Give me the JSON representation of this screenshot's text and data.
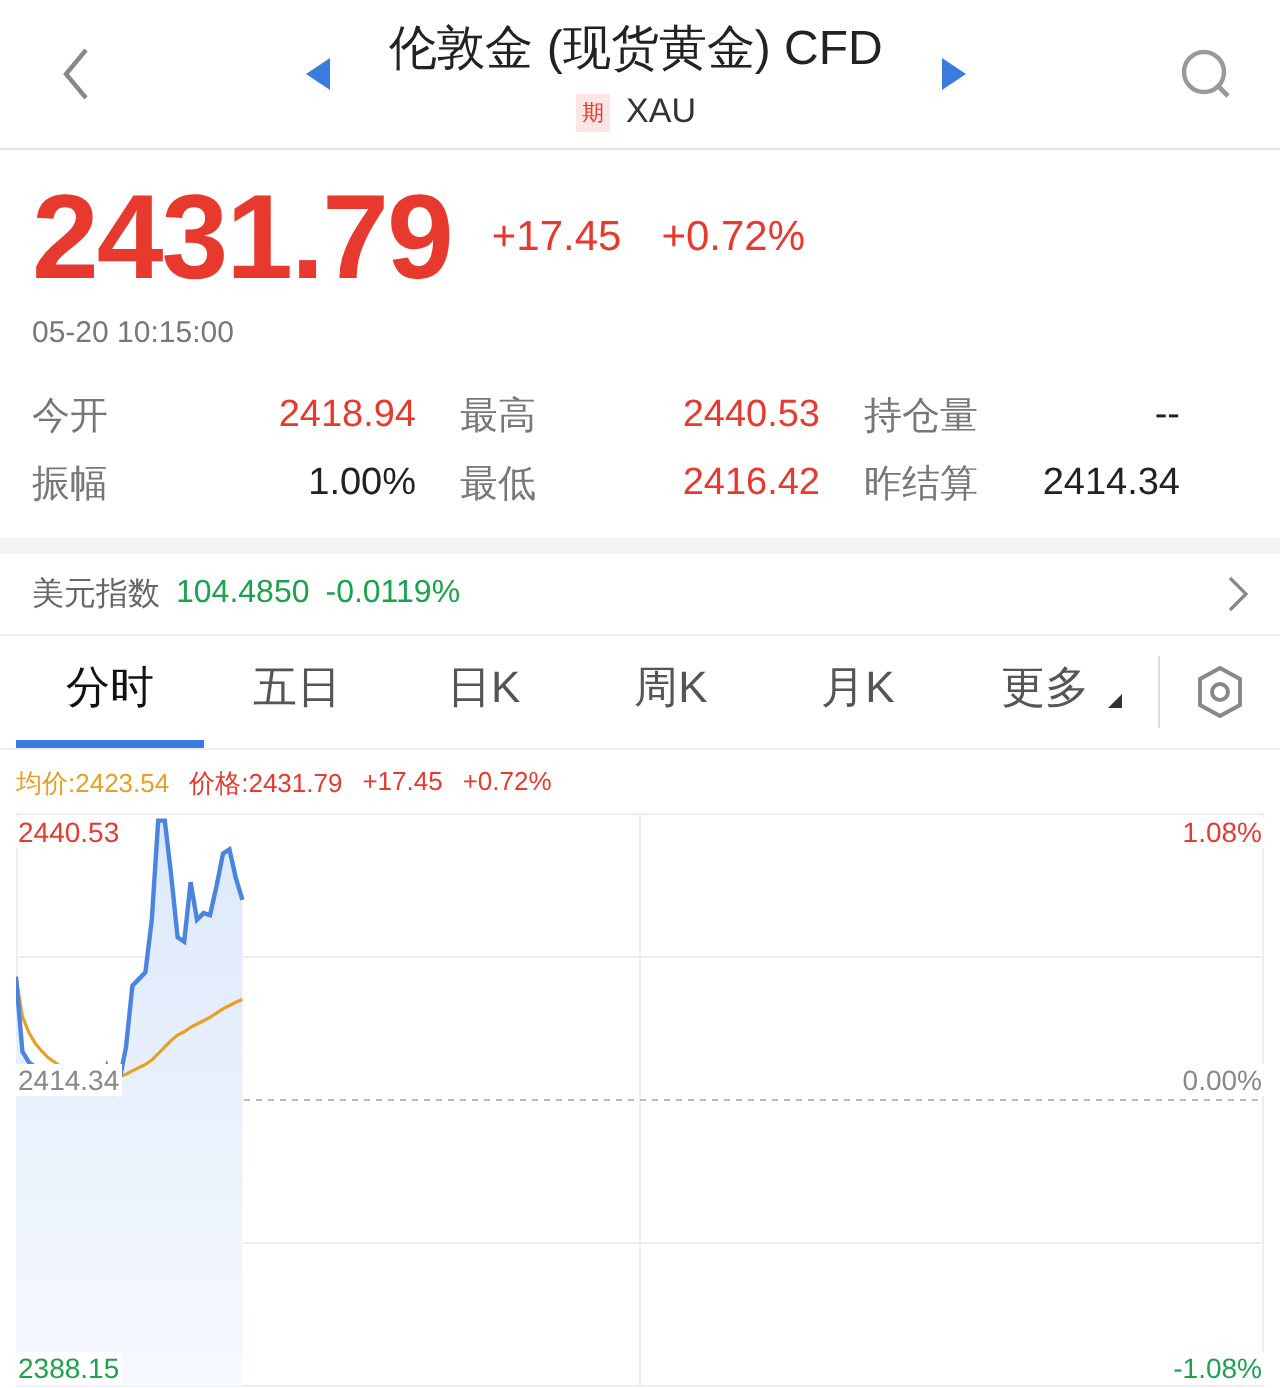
{
  "header": {
    "title": "伦敦金 (现货黄金) CFD",
    "badge": "期",
    "symbol": "XAU"
  },
  "quote": {
    "price": "2431.79",
    "change": "+17.45",
    "percent": "+0.72%",
    "time": "05-20 10:15:00"
  },
  "stats": [
    {
      "label": "今开",
      "value": "2418.94",
      "color": "#e8392e"
    },
    {
      "label": "最高",
      "value": "2440.53",
      "color": "#e8392e"
    },
    {
      "label": "持仓量",
      "value": "--",
      "color": "#222222"
    },
    {
      "label": "振幅",
      "value": "1.00%",
      "color": "#222222"
    },
    {
      "label": "最低",
      "value": "2416.42",
      "color": "#e8392e"
    },
    {
      "label": "昨结算",
      "value": "2414.34",
      "color": "#222222"
    }
  ],
  "index_row": {
    "label": "美元指数",
    "value": "104.4850",
    "change": "-0.0119%"
  },
  "tabs": [
    {
      "label": "分时",
      "selected": true,
      "kind": "plain"
    },
    {
      "label": "五日",
      "selected": false,
      "kind": "plain"
    },
    {
      "label": "日K",
      "selected": false,
      "kind": "plain"
    },
    {
      "label": "周K",
      "selected": false,
      "kind": "plain"
    },
    {
      "label": "月K",
      "selected": false,
      "kind": "plain"
    },
    {
      "label": "更多",
      "selected": false,
      "kind": "dropdown"
    }
  ],
  "chart": {
    "legend": [
      {
        "text": "均价:2423.54",
        "color": "#e8a023"
      },
      {
        "text": "价格:2431.79",
        "color": "#e8392e"
      },
      {
        "text": "+17.45",
        "color": "#e8392e"
      },
      {
        "text": "+0.72%",
        "color": "#e8392e"
      }
    ],
    "left_labels": [
      "2440.53",
      "2414.34",
      "2388.15"
    ],
    "right_labels": [
      "1.08%",
      "0.00%",
      "-1.08%"
    ]
  }
}
